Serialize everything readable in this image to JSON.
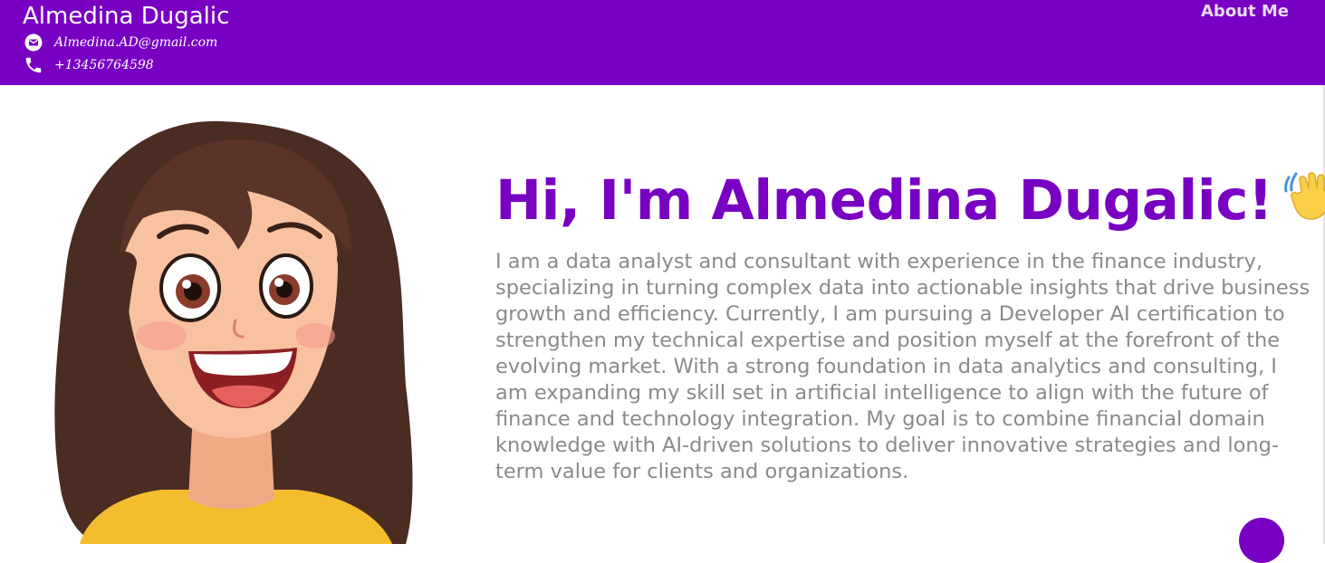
{
  "header": {
    "name": "Almedina Dugalic",
    "email": "Almedina.AD@gmail.com",
    "phone": "+13456764598",
    "nav": {
      "about_label": "About Me"
    }
  },
  "hero": {
    "title": "Hi, I'm Almedina Dugalic!",
    "bio": "I am a data analyst and consultant with experience in the finance industry, specializing in turning complex data into actionable insights that drive business growth and efficiency. Currently, I am pursuing a Developer AI certification to strengthen my technical expertise and position myself at the forefront of the evolving market. With a strong foundation in data analytics and consulting, I am expanding my skill set in artificial intelligence to align with the future of finance and technology integration. My goal is to combine financial domain knowledge with AI-driven solutions to deliver innovative strategies and long-term value for clients and organizations."
  },
  "icons": {
    "email": "envelope-icon",
    "phone": "phone-icon",
    "wave": "waving-hand-icon",
    "fab": "floating-action-button"
  },
  "colors": {
    "brand": "#7800c2",
    "header_text": "#ffffff",
    "body_text": "#8a8a8a"
  }
}
